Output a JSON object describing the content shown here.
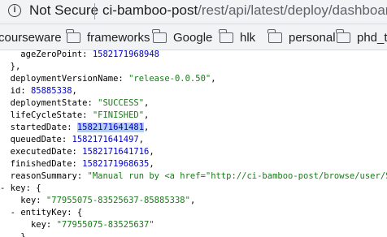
{
  "browser": {
    "security_label": "Not Secure",
    "url_host": "ci-bamboo-post",
    "url_path": "/rest/api/latest/deploy/dashboard",
    "info_icon": "info-icon"
  },
  "bookmarks": [
    {
      "label": "courseware",
      "icon": null
    },
    {
      "label": "frameworks",
      "icon": "folder-icon"
    },
    {
      "label": "Google",
      "icon": "folder-icon"
    },
    {
      "label": "hlk",
      "icon": "folder-icon"
    },
    {
      "label": "personal",
      "icon": "folder-icon"
    },
    {
      "label": "phd_th",
      "icon": "folder-icon"
    }
  ],
  "json_lines": [
    {
      "indent": "    ",
      "toggle": "",
      "key": "ageZeroPoint",
      "value": "1582171968948",
      "vtype": "n",
      "suffix": ""
    },
    {
      "indent": "  ",
      "toggle": "",
      "key": "",
      "value": "",
      "vtype": "",
      "suffix": "},"
    },
    {
      "indent": "  ",
      "toggle": "",
      "key": "deploymentVersionName",
      "value": "\"release-0.0.50\"",
      "vtype": "s",
      "suffix": ","
    },
    {
      "indent": "  ",
      "toggle": "",
      "key": "id",
      "value": "85885338",
      "vtype": "n",
      "suffix": ","
    },
    {
      "indent": "  ",
      "toggle": "",
      "key": "deploymentState",
      "value": "\"SUCCESS\"",
      "vtype": "s",
      "suffix": ","
    },
    {
      "indent": "  ",
      "toggle": "",
      "key": "lifeCycleState",
      "value": "\"FINISHED\"",
      "vtype": "s",
      "suffix": ","
    },
    {
      "indent": "  ",
      "toggle": "",
      "key": "startedDate",
      "value": "1582171641481",
      "vtype": "n",
      "suffix": ",",
      "selected": true
    },
    {
      "indent": "  ",
      "toggle": "",
      "key": "queuedDate",
      "value": "1582171641497",
      "vtype": "n",
      "suffix": ","
    },
    {
      "indent": "  ",
      "toggle": "",
      "key": "executedDate",
      "value": "1582171641716",
      "vtype": "n",
      "suffix": ","
    },
    {
      "indent": "  ",
      "toggle": "",
      "key": "finishedDate",
      "value": "1582171968635",
      "vtype": "n",
      "suffix": ","
    },
    {
      "indent": "  ",
      "toggle": "",
      "key": "reasonSummary",
      "value": "\"Manual run by <a href=\"http://ci-bamboo-post/browse/user/Sa",
      "vtype": "s",
      "suffix": ""
    },
    {
      "indent": "",
      "toggle": "- ",
      "key": "key",
      "value": "",
      "vtype": "",
      "suffix": "{"
    },
    {
      "indent": "    ",
      "toggle": "",
      "key": "key",
      "value": "\"77955075-83525637-85885338\"",
      "vtype": "s",
      "suffix": ","
    },
    {
      "indent": "  ",
      "toggle": "- ",
      "key": "entityKey",
      "value": "",
      "vtype": "",
      "suffix": "{"
    },
    {
      "indent": "      ",
      "toggle": "",
      "key": "key",
      "value": "\"77955075-83525637\"",
      "vtype": "s",
      "suffix": ""
    },
    {
      "indent": "    ",
      "toggle": "",
      "key": "",
      "value": "",
      "vtype": "",
      "suffix": "},"
    }
  ]
}
